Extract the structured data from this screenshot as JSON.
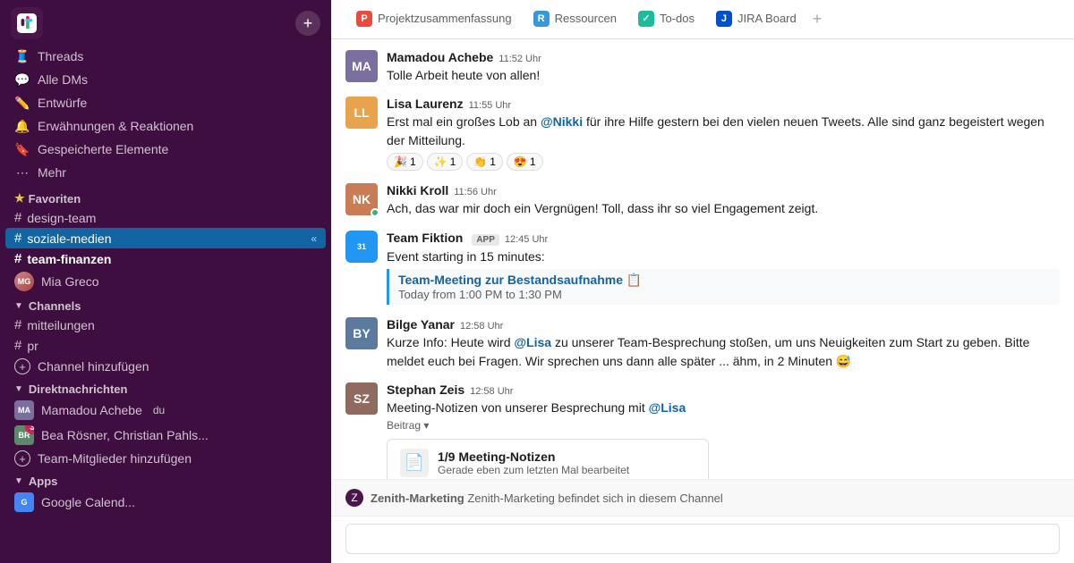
{
  "sidebar": {
    "workspace_icon": "S",
    "nav_items": [
      {
        "id": "threads",
        "icon": "🧵",
        "label": "Threads"
      },
      {
        "id": "alle-dms",
        "icon": "💬",
        "label": "Alle DMs"
      },
      {
        "id": "entwuerfe",
        "icon": "✏️",
        "label": "Entwürfe"
      },
      {
        "id": "erwahnungen",
        "icon": "🔔",
        "label": "Erwähnungen & Reaktionen"
      },
      {
        "id": "gespeicherte",
        "icon": "🔖",
        "label": "Gespeicherte Elemente"
      },
      {
        "id": "mehr",
        "icon": "⋯",
        "label": "Mehr"
      }
    ],
    "favoriten_label": "Favoriten",
    "favoriten_channels": [
      {
        "id": "design-team",
        "label": "design-team",
        "bold": false
      },
      {
        "id": "soziale-medien",
        "label": "soziale-medien",
        "active": true
      },
      {
        "id": "team-finanzen",
        "label": "team-finanzen",
        "bold": true
      }
    ],
    "mia_greco": "Mia Greco",
    "channels_label": "Channels",
    "channels": [
      {
        "id": "mitteilungen",
        "label": "mitteilungen"
      },
      {
        "id": "pr",
        "label": "pr"
      }
    ],
    "add_channel_label": "Channel hinzufügen",
    "direktnachrichten_label": "Direktnachrichten",
    "dms": [
      {
        "id": "mamadou",
        "label": "Mamadou Achebe",
        "suffix": "du"
      },
      {
        "id": "bea",
        "label": "Bea Rösner, Christian Pahls...",
        "badge": "3"
      }
    ],
    "add_members_label": "Team-Mitglieder hinzufügen",
    "apps_label": "Apps",
    "apps_item": "Google Calend..."
  },
  "main": {
    "tabs": [
      {
        "id": "projektzusammenfassung",
        "label": "Projektzusammenfassung",
        "color": "#e74c3c"
      },
      {
        "id": "ressourcen",
        "label": "Ressourcen",
        "color": "#3498db"
      },
      {
        "id": "to-dos",
        "label": "To-dos",
        "color": "#1abc9c"
      },
      {
        "id": "jira-board",
        "label": "JIRA Board",
        "color": "#0052cc"
      }
    ],
    "messages": [
      {
        "id": "msg1",
        "author": "Mamadou Achebe",
        "time": "11:52 Uhr",
        "text": "Tolle Arbeit heute von allen!",
        "avatar_color": "#7b6fa0",
        "avatar_letter": "M"
      },
      {
        "id": "msg2",
        "author": "Lisa Laurenz",
        "time": "11:55 Uhr",
        "text_html": "Erst mal ein großes Lob an <span class=\"mention\">@Nikki</span> für ihre Hilfe gestern bei den vielen neuen Tweets. Alle sind ganz begeistert wegen der Mitteilung.",
        "avatar_color": "#e8a44c",
        "avatar_letter": "L",
        "reactions": [
          {
            "emoji": "🎉",
            "count": "1"
          },
          {
            "emoji": "✨",
            "count": "1"
          },
          {
            "emoji": "👏",
            "count": "1"
          },
          {
            "emoji": "😍",
            "count": "1"
          }
        ]
      },
      {
        "id": "msg3",
        "author": "Nikki Kroll",
        "time": "11:56 Uhr",
        "text": "Ach, das war mir doch ein Vergnügen! Toll, dass ihr so viel Engagement zeigt.",
        "avatar_color": "#c97d54",
        "avatar_letter": "N",
        "has_status": true
      },
      {
        "id": "msg4",
        "author": "Team Fiktion",
        "app_badge": "APP",
        "time": "12:45 Uhr",
        "text": "Event starting in 15 minutes:",
        "avatar_type": "calendar",
        "cal_num": "31",
        "event_title": "Team-Meeting zur Bestandsaufnahme 📋",
        "event_time": "Today from 1:00 PM to 1:30 PM"
      },
      {
        "id": "msg5",
        "author": "Bilge Yanar",
        "time": "12:58 Uhr",
        "text_html": "Kurze Info: Heute wird <span class=\"mention\">@Lisa</span> zu unserer Team-Besprechung stoßen, um uns Neuigkeiten zum Start zu geben. Bitte meldet euch bei Fragen. Wir sprechen uns dann alle später ... ähm, in 2 Minuten 😅",
        "avatar_color": "#5c7a9e",
        "avatar_letter": "B"
      },
      {
        "id": "msg6",
        "author": "Stephan Zeis",
        "time": "12:58 Uhr",
        "text_html": "Meeting-Notizen von unserer Besprechung mit <span class=\"mention\">@Lisa</span>",
        "avatar_color": "#8e6b5e",
        "avatar_letter": "S",
        "beitrag": "Beitrag ▾",
        "notes_title": "1/9 Meeting-Notizen",
        "notes_sub": "Gerade eben zum letzten Mal bearbeitet"
      }
    ],
    "channel_join_text": "Zenith-Marketing befindet sich in diesem Channel",
    "input_placeholder": ""
  }
}
